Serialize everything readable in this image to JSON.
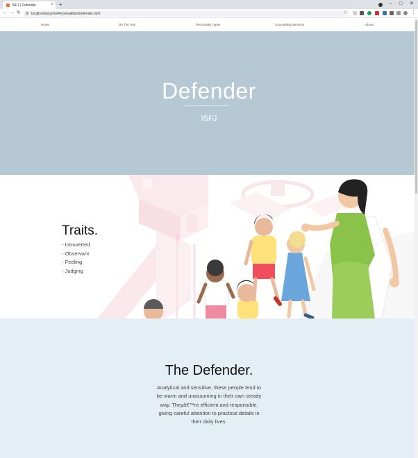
{
  "browser": {
    "tab_title": "ISFJ | Defender",
    "tab_close": "×",
    "new_tab": "+",
    "url": "localhost/psycho/Personalities/Defender.html",
    "back": "←",
    "forward": "→",
    "reload": "↻",
    "star": "☆",
    "menu": "⋮",
    "minimize": "–",
    "maximize": "□",
    "close": "✕"
  },
  "nav": {
    "items": [
      "Home",
      "Do The Test",
      "Personality Types",
      "Counselling Services",
      "About"
    ]
  },
  "hero": {
    "title": "Defender",
    "subtitle": "ISFJ"
  },
  "traits": {
    "heading": "Traits.",
    "items": [
      "- Introverted",
      "- Observant",
      "- Feeling",
      "- Judging"
    ]
  },
  "description": {
    "heading": "The Defender.",
    "body": "Analytical and sensitive, these people tend to be warm and unassuming in their own steady way. Theyâ€™re efficient and responsible, giving careful attention to practical details in their daily lives."
  },
  "colors": {
    "hero_bg": "#b5c8d4",
    "desc_bg": "#e4eef5",
    "playground_pink": "#f7d9df"
  }
}
